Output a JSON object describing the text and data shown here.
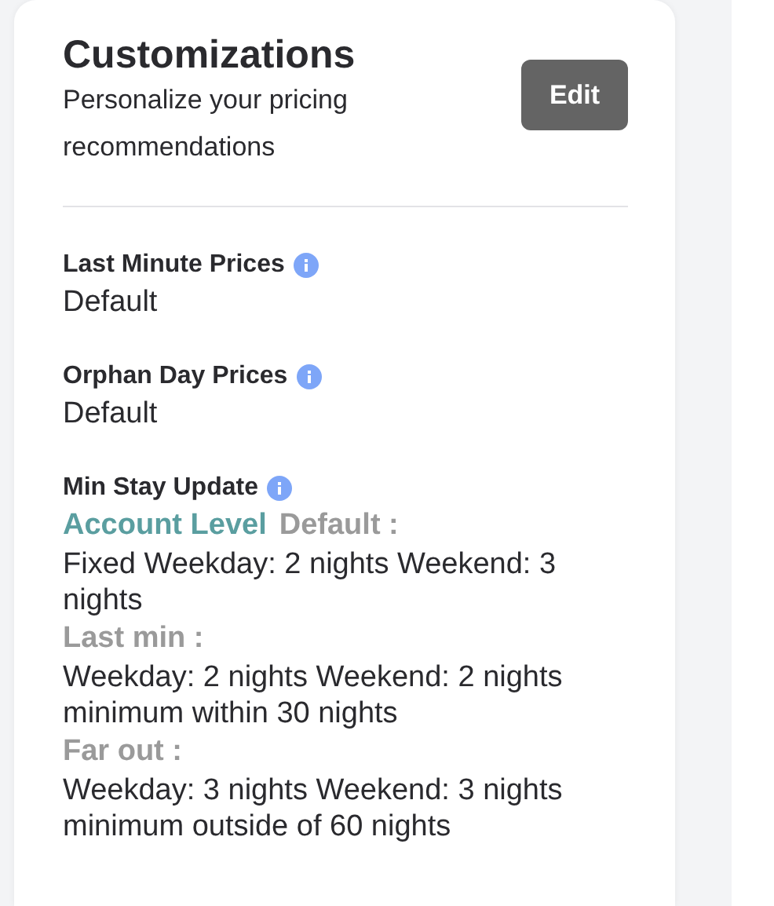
{
  "header": {
    "title": "Customizations",
    "subtitle": "Personalize your pricing recommendations",
    "edit_button": "Edit"
  },
  "settings": [
    {
      "kind": "simple",
      "label": "Last Minute Prices",
      "value": "Default"
    },
    {
      "kind": "simple",
      "label": "Orphan Day Prices",
      "value": "Default"
    },
    {
      "kind": "min_stay",
      "label": "Min Stay Update",
      "account_level": "Account Level",
      "sections": [
        {
          "label": "Default :",
          "value": "Fixed Weekday: 2 nights Weekend: 3 nights"
        },
        {
          "label": "Last min :",
          "value": "Weekday: 2 nights Weekend: 2 nights minimum within 30 nights"
        },
        {
          "label": "Far out :",
          "value": "Weekday: 3 nights Weekend: 3 nights minimum outside of 60 nights"
        }
      ]
    }
  ]
}
